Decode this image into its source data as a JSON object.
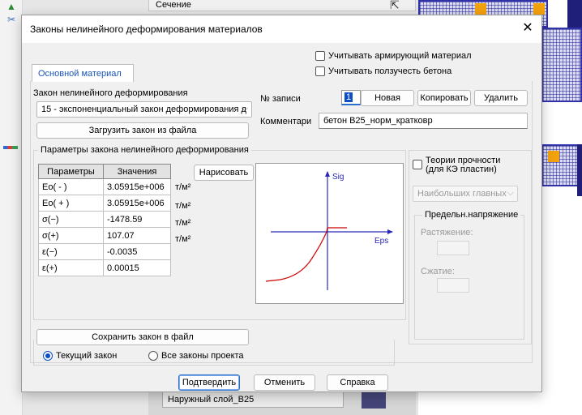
{
  "background": {
    "tab_label": "Сечение",
    "layer_name": "Наружный слой_B25"
  },
  "dialog": {
    "title": "Законы нелинейного деформирования материалов",
    "tab_label": "Основной материал",
    "checkboxes": {
      "reinforcing": "Учитывать армирующий материал",
      "creep": "Учитывать ползучесть бетона"
    },
    "law_label": "Закон нелинейного деформирования",
    "law_value": "15 - экспоненциальный закон деформирования д",
    "load_button": "Загрузить закон из файла",
    "record_label": "№ записи",
    "record_value": "1",
    "new_button": "Новая",
    "copy_button": "Копировать",
    "delete_button": "Удалить",
    "comment_label": "Комментари",
    "comment_value": "бетон B25_норм_кратковр",
    "params_group_title": "Параметры закона нелинейного деформирования",
    "params_table": {
      "headers": [
        "Параметры",
        "Значения"
      ],
      "rows": [
        [
          "Eo( - )",
          "3.05915e+006"
        ],
        [
          "Eo( + )",
          "3.05915e+006"
        ],
        [
          "σ(−)",
          "-1478.59"
        ],
        [
          "σ(+)",
          "107.07"
        ],
        [
          "ε(−)",
          "-0.0035"
        ],
        [
          "ε(+)",
          "0.00015"
        ]
      ]
    },
    "units": [
      "т/м²",
      "т/м²",
      "т/м²",
      "т/м²"
    ],
    "draw_button": "Нарисовать",
    "graph": {
      "y_axis_label": "Sig",
      "x_axis_label": "Eps",
      "curve_color": "#cc0000"
    },
    "strength": {
      "checkbox_label_1": "Теории прочности",
      "checkbox_label_2": "(для КЭ пластин)",
      "combo_value": "Наибольших главных",
      "group_title": "Предельн.напряжение",
      "tension_label": "Растяжение:",
      "compression_label": "Сжатие:"
    },
    "save_button": "Сохранить закон в файл",
    "radio_current": "Текущий закон",
    "radio_all": "Все законы проекта",
    "confirm_button": "Подтвердить",
    "cancel_button": "Отменить",
    "help_button": "Справка"
  }
}
